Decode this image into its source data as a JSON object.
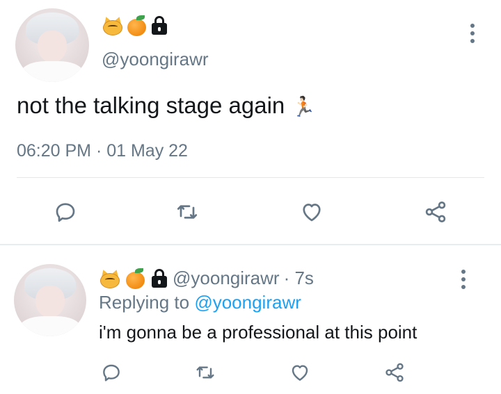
{
  "main_tweet": {
    "emojis": [
      "cat-emoji",
      "tangerine-emoji",
      "lock-icon"
    ],
    "handle": "@yoongirawr",
    "text": "not the talking stage again",
    "text_emoji": "🏃🏻",
    "timestamp": "06:20 PM · 01 May 22",
    "actions": [
      "reply-icon",
      "retweet-icon",
      "like-icon",
      "share-icon"
    ]
  },
  "reply_tweet": {
    "emojis": [
      "cat-emoji",
      "tangerine-emoji",
      "lock-icon"
    ],
    "handle": "@yoongirawr",
    "time_meta": "· 7s",
    "replying_prefix": "Replying to",
    "replying_to": "@yoongirawr",
    "text": "i'm gonna be a professional at this point",
    "actions": [
      "reply-icon",
      "retweet-icon",
      "like-icon",
      "share-icon"
    ]
  },
  "colors": {
    "text_primary": "#14171a",
    "text_secondary": "#657786",
    "link": "#1da1f2",
    "divider": "#e1e8ed"
  }
}
